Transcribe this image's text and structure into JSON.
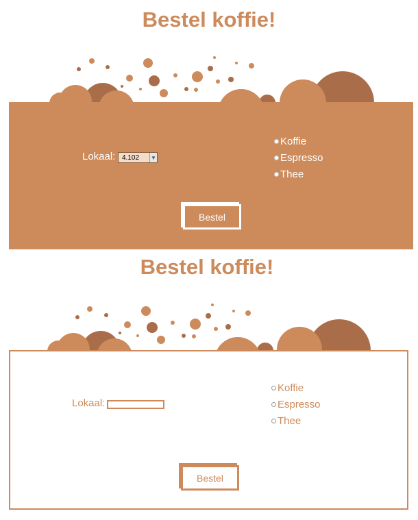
{
  "colors": {
    "brand": "#cd8a5a",
    "dark_bean": "#a96e49",
    "white": "#ffffff"
  },
  "forms": [
    {
      "variant": "filled",
      "title": "Bestel koffie!",
      "lokaal_label": "Lokaal:",
      "lokaal_value": "4.102",
      "options": [
        "Koffie",
        "Espresso",
        "Thee"
      ],
      "submit_label": "Bestel"
    },
    {
      "variant": "outline",
      "title": "Bestel koffie!",
      "lokaal_label": "Lokaal:",
      "lokaal_value": "",
      "options": [
        "Koffie",
        "Espresso",
        "Thee"
      ],
      "submit_label": "Bestel"
    }
  ]
}
